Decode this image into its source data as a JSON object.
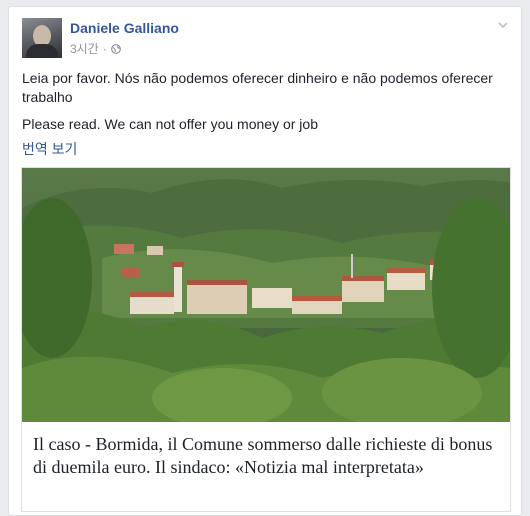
{
  "post": {
    "author": "Daniele Galliano",
    "time": "3시간",
    "privacy_icon": "globe-icon",
    "menu_icon": "chevron-down-icon",
    "text_pt": "Leia por favor. Nós não podemos oferecer dinheiro e não podemos oferecer trabalho",
    "text_en": "Please read. We can not offer you money or job",
    "translate_label": "번역 보기"
  },
  "link": {
    "headline": "Il caso - Bormida, il Comune sommerso dalle richieste di bonus di duemila euro. Il sindaco: «Notizia mal interpretata»"
  },
  "colors": {
    "link_blue": "#365899",
    "meta_gray": "#90949c",
    "text": "#1d2129"
  }
}
